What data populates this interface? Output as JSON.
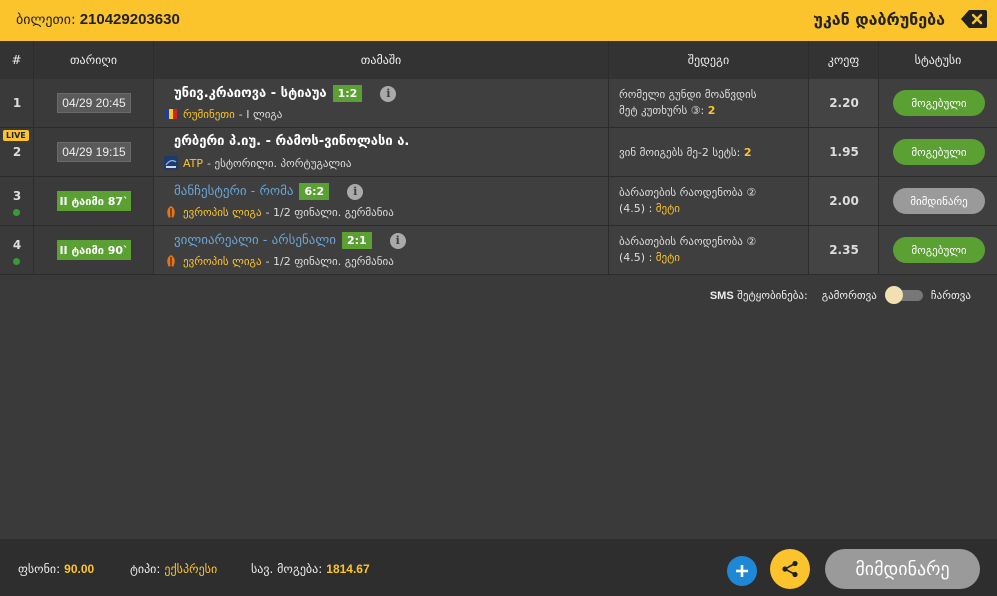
{
  "header": {
    "ticket_label": "ბილეთი:",
    "ticket_id": "210429203630",
    "back_label": "უკან დაბრუნება"
  },
  "table": {
    "columns": [
      "#",
      "თარიღი",
      "თამაში",
      "შედეგი",
      "კოეფ",
      "სტატუსი"
    ],
    "live_badge": "LIVE",
    "rows": [
      {
        "num": "1",
        "date": "04/29 20:45",
        "match": "უნივ.კრაიოვა - სტიაუა",
        "score": "1:2",
        "league_name": "რუმინეთი",
        "league_rest": "- I ლიგა",
        "bet_line1": "რომელი გუნდი მოაწვდის",
        "bet_line2": "მეტ კუთხურს ③:",
        "pick": "2",
        "odd": "2.20",
        "status": "მოგებული"
      },
      {
        "num": "2",
        "date": "04/29 19:15",
        "match": "ერბერი პ.იუ. - რამოს-ვინოლასი ა.",
        "league_name": "ATP",
        "league_rest": "- ესტორილი. პორტუგალია",
        "bet_line1": "ვინ მოიგებს მე-2 სეტს:",
        "pick": "2",
        "odd": "1.95",
        "status": "მოგებული"
      },
      {
        "num": "3",
        "half": "II ტაიმი 87`",
        "match": "მანჩესტერი - რომა",
        "score": "6:2",
        "league_name": "ევროპის ლიგა",
        "league_rest": "- 1/2 ფინალი. გერმანია",
        "bet_line1": "ბარათების რაოდენობა ②",
        "bet_line2": "(4.5) :",
        "pick": "მეტი",
        "odd": "2.00",
        "status": "მიმდინარე"
      },
      {
        "num": "4",
        "half": "II ტაიმი 90`",
        "match": "ვილიარეალი - არსენალი",
        "score": "2:1",
        "league_name": "ევროპის ლიგა",
        "league_rest": "- 1/2 ფინალი. გერმანია",
        "bet_line1": "ბარათების რაოდენობა ②",
        "bet_line2": "(4.5) :",
        "pick": "მეტი",
        "odd": "2.35",
        "status": "მოგებული"
      }
    ]
  },
  "sms": {
    "label_bold": "SMS",
    "label_rest": "შეტყობინება:",
    "off_label": "გამორთვა",
    "on_label": "ჩართვა",
    "state": "off"
  },
  "footer": {
    "stake_label": "ფსონი:",
    "stake_value": "90.00",
    "type_label": "ტიპი:",
    "type_value": "ექსპრესი",
    "win_label": "სავ. მოგება:",
    "win_value": "1814.67",
    "status_label": "მიმდინარე"
  },
  "colors": {
    "accent": "#fcc42c",
    "won": "#5aa032",
    "running": "#9a9a9a",
    "plus": "#1e88d6",
    "live_team": "#6aa5d8"
  }
}
